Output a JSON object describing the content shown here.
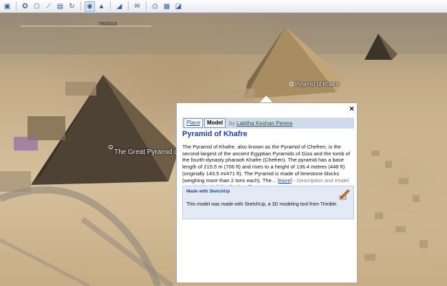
{
  "toolbar": {
    "buttons": [
      {
        "name": "sidebar-toggle-icon",
        "glyph": "▣"
      },
      {
        "name": "placemark-icon",
        "glyph": "✪"
      },
      {
        "name": "polygon-icon",
        "glyph": "⬠"
      },
      {
        "name": "path-icon",
        "glyph": "⟋"
      },
      {
        "name": "overlay-icon",
        "glyph": "▤"
      },
      {
        "name": "tour-icon",
        "glyph": "↻"
      },
      {
        "name": "planets-icon",
        "glyph": "◉"
      },
      {
        "name": "historical-imagery-icon",
        "glyph": "▲"
      },
      {
        "name": "ruler-icon",
        "glyph": "◢"
      },
      {
        "name": "email-icon",
        "glyph": "✉"
      },
      {
        "name": "print-icon",
        "glyph": "⎙"
      },
      {
        "name": "save-image-icon",
        "glyph": "▦"
      },
      {
        "name": "maps-icon",
        "glyph": "◪"
      }
    ]
  },
  "map": {
    "date_label": "7/6/2015",
    "labels": {
      "great_pyramid": "The Great Pyramid of Giza",
      "khafre": "Pyramid of Khafre"
    }
  },
  "popup": {
    "close": "×",
    "tabs": {
      "place": "Place",
      "model": "Model"
    },
    "by_prefix": "by",
    "author": "Lakitha Keshan Perera",
    "title": "Pyramid of Khafre",
    "description": "The Pyramid of Khafre, also known as the Pyramid of Chefren, is the second-largest of the ancient Egyptian Pyramids of Giza and the tomb of the fourth-dynasty pharaoh Khafre (Chefren). The pyramid has a base length of 215.5 m (706 ft) and rises to a height of 136.4 metres (448 ft) (originally 143.5 m/471 ft). The Pyramid is made of limestone blocks (weighing more than 2 tons each). The...",
    "more": "[more]",
    "provided_by": "- Description and model provided by",
    "sketchup": {
      "title": "Made with SketchUp",
      "text": "This model was made with SketchUp, a 3D modeling tool from Trimble.",
      "icon": "sketchup-pencil-icon"
    }
  }
}
